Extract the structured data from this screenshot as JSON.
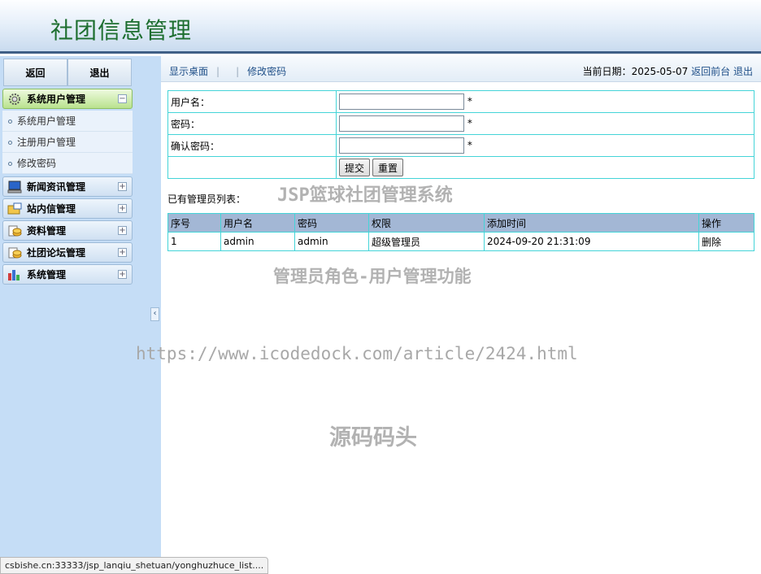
{
  "header": {
    "title": "社团信息管理"
  },
  "sidebar": {
    "back_label": "返回",
    "logout_label": "退出",
    "groups": [
      {
        "label": "系统用户管理",
        "icon": "gear-icon",
        "expanded": true,
        "items": [
          {
            "label": "系统用户管理"
          },
          {
            "label": "注册用户管理"
          },
          {
            "label": "修改密码"
          }
        ]
      },
      {
        "label": "新闻资讯管理",
        "icon": "monitor-icon"
      },
      {
        "label": "站内信管理",
        "icon": "folder-mail-icon"
      },
      {
        "label": "资料管理",
        "icon": "coins-icon"
      },
      {
        "label": "社团论坛管理",
        "icon": "coins-icon"
      },
      {
        "label": "系统管理",
        "icon": "bar-chart-icon"
      }
    ],
    "collapse_glyph": "‹",
    "toggle_expanded": "−",
    "toggle_collapsed": "+"
  },
  "topbar": {
    "show_desktop": "显示桌面",
    "change_password": "修改密码",
    "date_label": "当前日期：",
    "date_value": "2025-05-07",
    "back_front": "返回前台",
    "logout": "退出"
  },
  "form": {
    "username_label": "用户名：",
    "password_label": "密码：",
    "confirm_label": "确认密码：",
    "required_mark": "*",
    "submit_label": "提交",
    "reset_label": "重置"
  },
  "list": {
    "title": "已有管理员列表：",
    "headers": [
      "序号",
      "用户名",
      "密码",
      "权限",
      "添加时间",
      "操作"
    ],
    "rows": [
      {
        "no": "1",
        "username": "admin",
        "password": "admin",
        "role": "超级管理员",
        "added": "2024-09-20 21:31:09",
        "action": "删除"
      }
    ]
  },
  "watermarks": {
    "w1": "JSP篮球社团管理系统",
    "w2": "管理员角色-用户管理功能",
    "w3": "https://www.icodedock.com/article/2424.html",
    "w4": "源码码头"
  },
  "status_url": "csbishe.cn:33333/jsp_lanqiu_shetuan/yonghuzhuce_list...."
}
